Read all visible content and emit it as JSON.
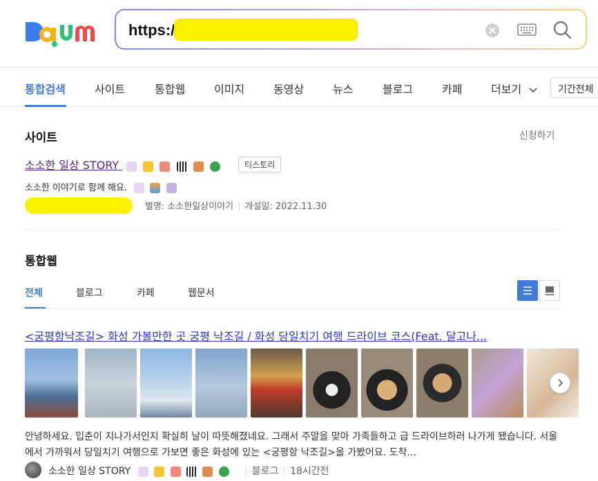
{
  "search": {
    "query": "https:/",
    "clear_label": "×"
  },
  "tabs": [
    {
      "label": "통합검색"
    },
    {
      "label": "사이트"
    },
    {
      "label": "통합웹"
    },
    {
      "label": "이미지"
    },
    {
      "label": "동영상"
    },
    {
      "label": "뉴스"
    },
    {
      "label": "블로그"
    },
    {
      "label": "카페"
    },
    {
      "label": "더보기"
    }
  ],
  "period_label": "기간전체",
  "site_section": {
    "title": "사이트",
    "apply_label": "신청하기",
    "site_name": "소소한 일상 STORY",
    "badge": "티스토리",
    "description": "소소한 이야기로 함께 해요.",
    "alias": "별명: 소소한일상이야기",
    "opened": "개설일: 2022.11.30"
  },
  "web_section": {
    "title": "통합웹",
    "subtabs": [
      {
        "label": "전체"
      },
      {
        "label": "블로그"
      },
      {
        "label": "카페"
      },
      {
        "label": "웹문서"
      }
    ],
    "result": {
      "title": "<궁평항낙조길> 화성 가볼만한 곳 궁평 낙조길 / 화성 당일치기 여행 드라이브 코스(Feat. 달고나...",
      "snippet": "안녕하세요. 입춘이 지나가서인지 확실히 날이 따뜻해졌네요. 그래서 주말을 맞아 가족들하고 급 드라이브하러 나가게 됐습니다. 서울에서 가까워서 당일치기 여행으로 가보면 좋은 화성에 있는 <궁평항 낙조길>을 가봤어요. 도착...",
      "author": "소소한 일상 STORY",
      "source": "블로그",
      "time": "18시간전"
    }
  },
  "colors": {
    "accent": "#3f7bd8",
    "link": "#2a37c9",
    "visited": "#5b1f8f",
    "mask": "#fbf200"
  }
}
